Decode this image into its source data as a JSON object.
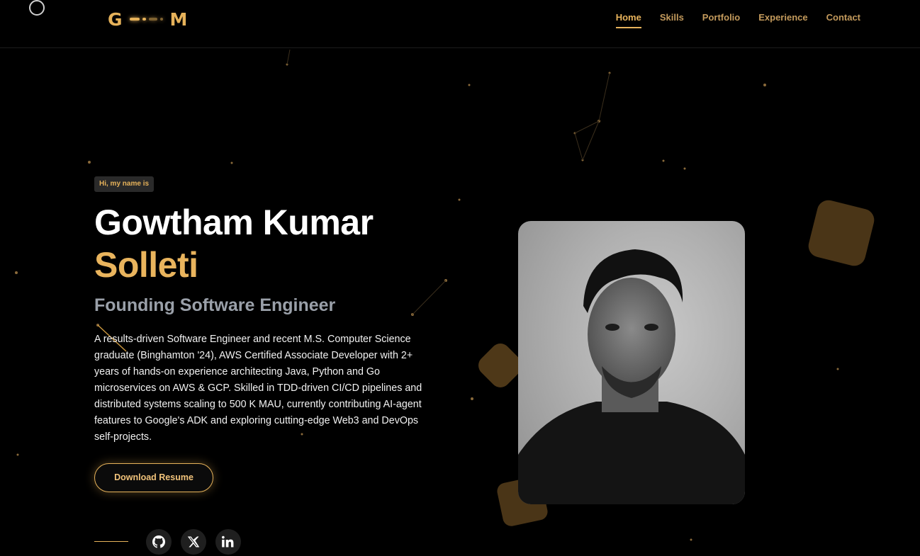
{
  "logo": {
    "left": "G",
    "right": "M"
  },
  "nav": {
    "items": [
      {
        "label": "Home",
        "active": true
      },
      {
        "label": "Skills",
        "active": false
      },
      {
        "label": "Portfolio",
        "active": false
      },
      {
        "label": "Experience",
        "active": false
      },
      {
        "label": "Contact",
        "active": false
      }
    ]
  },
  "hero": {
    "tag": "Hi, my name is",
    "first_name": "Gowtham Kumar",
    "last_name": "Solleti",
    "role": "Founding Software Engineer",
    "bio": "A results-driven Software Engineer and recent M.S. Computer Science graduate (Binghamton '24), AWS Certified Associate Developer with 2+ years of hands-on experience architecting Java, Python and Go microservices on AWS & GCP. Skilled in TDD-driven CI/CD pipelines and distributed systems scaling to 500 K MAU, currently contributing AI-agent features to Google's ADK and exploring cutting-edge Web3 and DevOps self-projects.",
    "resume_button": "Download Resume"
  },
  "social": [
    {
      "icon": "github-icon"
    },
    {
      "icon": "x-icon"
    },
    {
      "icon": "linkedin-icon"
    }
  ],
  "colors": {
    "accent": "#e6b25a",
    "background": "#000000",
    "muted": "#9aa0a9"
  }
}
